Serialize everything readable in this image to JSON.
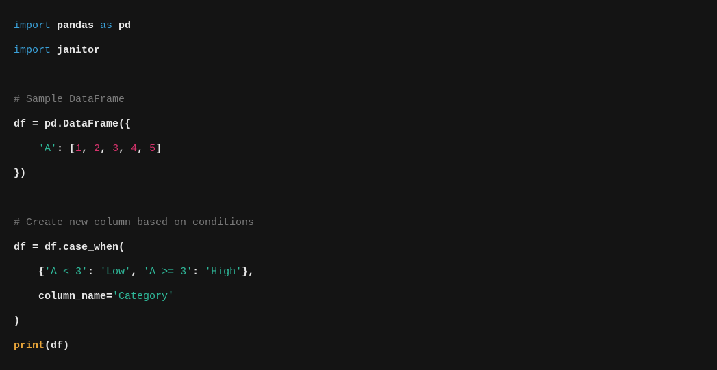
{
  "code": {
    "l1_import": "import",
    "l1_mod": " pandas ",
    "l1_as": "as",
    "l1_alias": " pd",
    "l2_import": "import",
    "l2_mod": " janitor",
    "blank1": "",
    "l3_cmt": "# Sample DataFrame",
    "l4": "df = pd.DataFrame({",
    "l5_indent": "    ",
    "l5_keyA": "'A'",
    "l5_colon_open": ": [",
    "l5_n1": "1",
    "l5_c1": ", ",
    "l5_n2": "2",
    "l5_c2": ", ",
    "l5_n3": "3",
    "l5_c3": ", ",
    "l5_n4": "4",
    "l5_c4": ", ",
    "l5_n5": "5",
    "l5_close": "]",
    "l6": "})",
    "blank2": "",
    "l7_cmt": "# Create new column based on conditions",
    "l8": "df = df.case_when(",
    "l9_indent": "    {",
    "l9_k1": "'A < 3'",
    "l9_sep1": ": ",
    "l9_v1": "'Low'",
    "l9_comma": ", ",
    "l9_k2": "'A >= 3'",
    "l9_sep2": ": ",
    "l9_v2": "'High'",
    "l9_close": "},",
    "l10_indent": "    column_name=",
    "l10_val": "'Category'",
    "l11": ")",
    "l12_fn": "print",
    "l12_open": "(df)"
  }
}
